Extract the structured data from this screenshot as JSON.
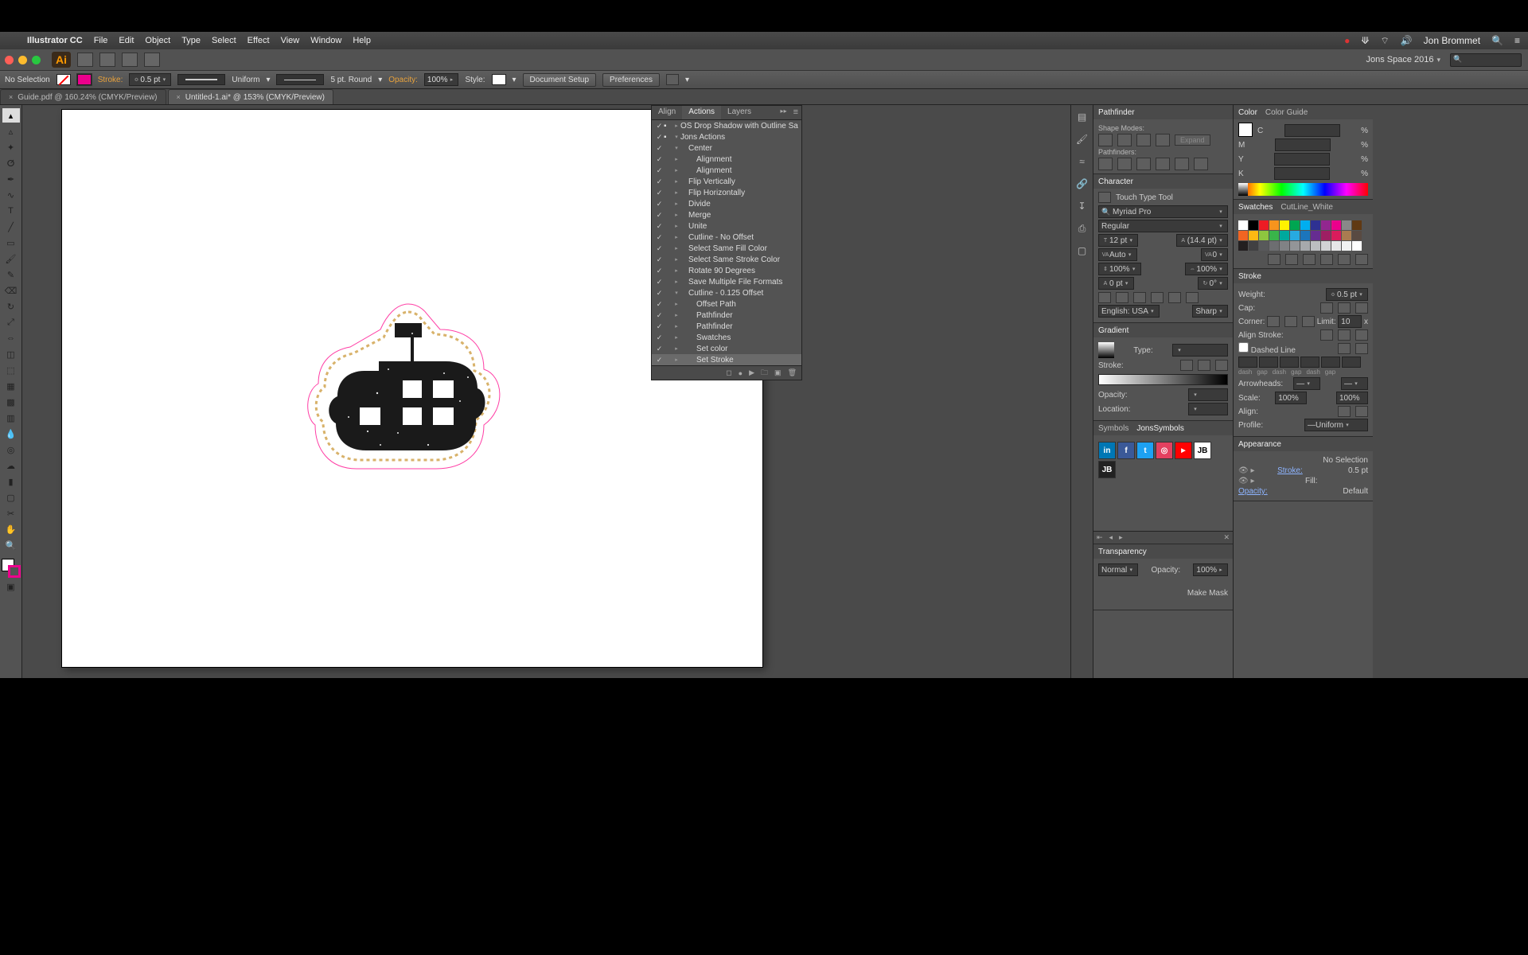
{
  "menubar": {
    "app": "Illustrator CC",
    "items": [
      "File",
      "Edit",
      "Object",
      "Type",
      "Select",
      "Effect",
      "View",
      "Window",
      "Help"
    ],
    "user": "Jon Brommet"
  },
  "appchrome": {
    "workspace": "Jons Space 2016"
  },
  "controlbar": {
    "selection": "No Selection",
    "stroke_label": "Stroke:",
    "stroke_weight": "0.5 pt",
    "profile": "Uniform",
    "brush": "5 pt. Round",
    "opacity_label": "Opacity:",
    "opacity": "100%",
    "style_label": "Style:",
    "btn_docsetup": "Document Setup",
    "btn_prefs": "Preferences"
  },
  "tabs": [
    {
      "label": "Guide.pdf @ 160.24% (CMYK/Preview)"
    },
    {
      "label": "Untitled-1.ai* @ 153% (CMYK/Preview)"
    }
  ],
  "actions": {
    "tabs": [
      "Align",
      "Actions",
      "Layers"
    ],
    "items": [
      {
        "name": "OS Drop Shadow with Outline Sa",
        "i": 0,
        "folder": true
      },
      {
        "name": "Jons Actions",
        "i": 0,
        "folder": true,
        "open": true
      },
      {
        "name": "Center",
        "i": 1,
        "open": true
      },
      {
        "name": "Alignment",
        "i": 2
      },
      {
        "name": "Alignment",
        "i": 2
      },
      {
        "name": "Flip Vertically",
        "i": 1
      },
      {
        "name": "Flip Horizontally",
        "i": 1
      },
      {
        "name": "Divide",
        "i": 1
      },
      {
        "name": "Merge",
        "i": 1
      },
      {
        "name": "Unite",
        "i": 1
      },
      {
        "name": "Cutline - No Offset",
        "i": 1
      },
      {
        "name": "Select Same Fill Color",
        "i": 1
      },
      {
        "name": "Select Same Stroke Color",
        "i": 1
      },
      {
        "name": "Rotate 90 Degrees",
        "i": 1
      },
      {
        "name": "Save Multiple File Formats",
        "i": 1
      },
      {
        "name": "Cutline - 0.125 Offset",
        "i": 1,
        "open": true
      },
      {
        "name": "Offset Path",
        "i": 2
      },
      {
        "name": "Pathfinder",
        "i": 2
      },
      {
        "name": "Pathfinder",
        "i": 2
      },
      {
        "name": "Swatches",
        "i": 2
      },
      {
        "name": "Set color",
        "i": 2
      },
      {
        "name": "Set Stroke",
        "i": 2,
        "sel": true
      }
    ]
  },
  "pathfinder": {
    "title": "Pathfinder",
    "shape": "Shape Modes:",
    "path": "Pathfinders:",
    "expand": "Expand"
  },
  "character": {
    "title": "Character",
    "touch": "Touch Type Tool",
    "font": "Myriad Pro",
    "style": "Regular",
    "size": "12 pt",
    "leading": "(14.4 pt)",
    "kerning": "Auto",
    "tracking": "0",
    "vscale": "100%",
    "hscale": "100%",
    "baseline": "0 pt",
    "rotate": "0°",
    "lang": "English: USA",
    "aa": "Sharp"
  },
  "gradient": {
    "title": "Gradient",
    "type_l": "Type:",
    "stroke_l": "Stroke:",
    "opacity_l": "Opacity:",
    "location_l": "Location:"
  },
  "symbols": {
    "tabs": [
      "Symbols",
      "JonsSymbols"
    ]
  },
  "transparency": {
    "title": "Transparency",
    "mode": "Normal",
    "opacity_l": "Opacity:",
    "opacity": "100%",
    "mask": "Make Mask"
  },
  "color": {
    "tabs": [
      "Color",
      "Color Guide"
    ],
    "c": "C",
    "m": "M",
    "y": "Y",
    "k": "K",
    "pct": "%"
  },
  "swatches": {
    "tabs": [
      "Swatches",
      "CutLine_White"
    ],
    "colors": [
      "#ffffff",
      "#000000",
      "#ed1c24",
      "#f7941d",
      "#fff200",
      "#00a651",
      "#00aeef",
      "#2e3192",
      "#92278f",
      "#ec008c",
      "#898989",
      "#603913",
      "#f26522",
      "#fdb913",
      "#8dc63f",
      "#39b54a",
      "#00a99d",
      "#27aae1",
      "#1c75bc",
      "#662d91",
      "#9e1f63",
      "#da1c5c",
      "#a97c50",
      "#594a42",
      "#231f20",
      "#414042",
      "#58595b",
      "#6d6e71",
      "#808285",
      "#939598",
      "#a7a9ac",
      "#bcbec0",
      "#d1d3d4",
      "#e6e7e8",
      "#f1f2f2",
      "#ffffff"
    ]
  },
  "stroke": {
    "title": "Stroke",
    "weight_l": "Weight:",
    "weight": "0.5 pt",
    "cap_l": "Cap:",
    "corner_l": "Corner:",
    "limit_l": "Limit:",
    "limit": "10",
    "limit_x": "x",
    "align_l": "Align Stroke:",
    "dashed": "Dashed Line",
    "dash": "dash",
    "gap": "gap",
    "arrow_l": "Arrowheads:",
    "scale_l": "Scale:",
    "scale": "100%",
    "stralign_l": "Align:",
    "profile_l": "Profile:",
    "profile": "Uniform"
  },
  "appearance": {
    "title": "Appearance",
    "nosel": "No Selection",
    "stroke_l": "Stroke:",
    "stroke_v": "0.5 pt",
    "fill_l": "Fill:",
    "opacity_l": "Opacity:",
    "opacity_v": "Default"
  }
}
